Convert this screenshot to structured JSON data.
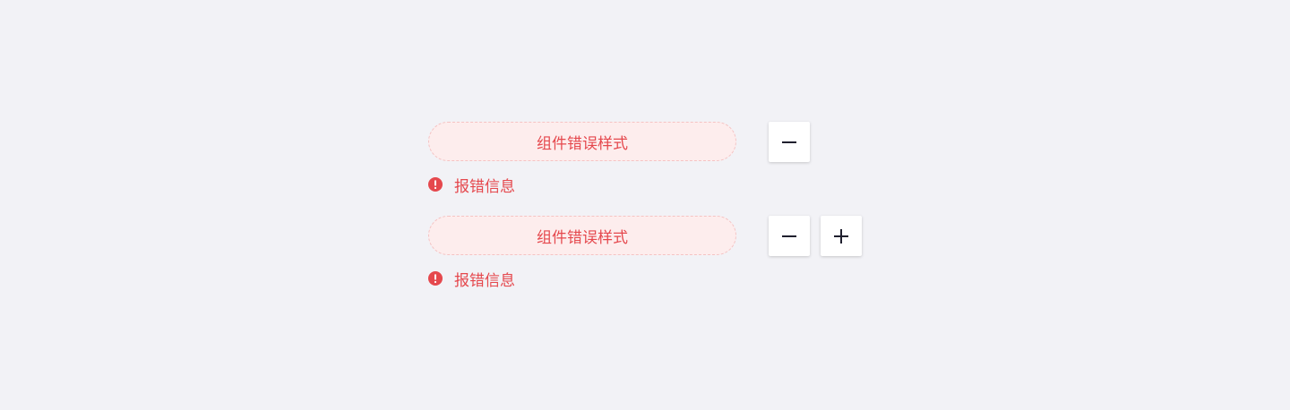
{
  "colors": {
    "background": "#f2f2f6",
    "error_text": "#e5484d",
    "field_fill": "#fdeded",
    "field_border": "#f5c3c3",
    "button_bg": "#ffffff",
    "icon_dark": "#1f1f2e"
  },
  "rows": [
    {
      "field_text": "组件错误样式",
      "error_message": "报错信息",
      "error_icon": "exclamation-circle-icon",
      "buttons": [
        "minus-icon"
      ]
    },
    {
      "field_text": "组件错误样式",
      "error_message": "报错信息",
      "error_icon": "exclamation-circle-icon",
      "buttons": [
        "minus-icon",
        "plus-icon"
      ]
    }
  ]
}
